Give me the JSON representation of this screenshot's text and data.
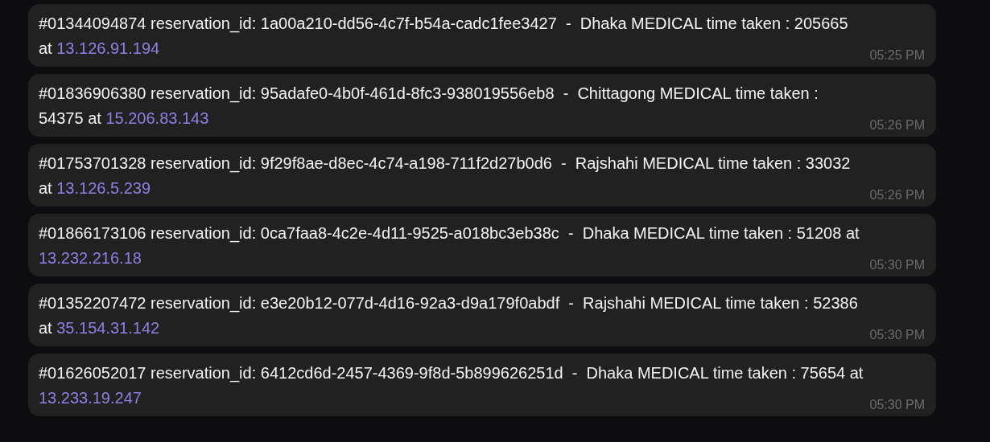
{
  "messages": [
    {
      "text": "#01344094874 reservation_id: 1a00a210-dd56-4c7f-b54a-cadc1fee3427  -  Dhaka MEDICAL time taken : 205665 at ",
      "link": "13.126.91.194",
      "time": "05:25 PM"
    },
    {
      "text": "#01836906380 reservation_id: 95adafe0-4b0f-461d-8fc3-938019556eb8  -  Chittagong MEDICAL time taken : 54375 at ",
      "link": "15.206.83.143",
      "time": "05:26 PM"
    },
    {
      "text": "#01753701328 reservation_id: 9f29f8ae-d8ec-4c74-a198-711f2d27b0d6  -  Rajshahi MEDICAL time taken : 33032 at ",
      "link": "13.126.5.239",
      "time": "05:26 PM"
    },
    {
      "text": "#01866173106 reservation_id: 0ca7faa8-4c2e-4d11-9525-a018bc3eb38c  -  Dhaka MEDICAL time taken : 51208 at ",
      "link": "13.232.216.18",
      "time": "05:30 PM"
    },
    {
      "text": "#01352207472 reservation_id: e3e20b12-077d-4d16-92a3-d9a179f0abdf  -  Rajshahi MEDICAL time taken : 52386 at ",
      "link": "35.154.31.142",
      "time": "05:30 PM"
    },
    {
      "text": "#01626052017 reservation_id: 6412cd6d-2457-4369-9f8d-5b899626251d  -  Dhaka MEDICAL time taken : 75654 at ",
      "link": "13.233.19.247",
      "time": "05:30 PM"
    }
  ]
}
